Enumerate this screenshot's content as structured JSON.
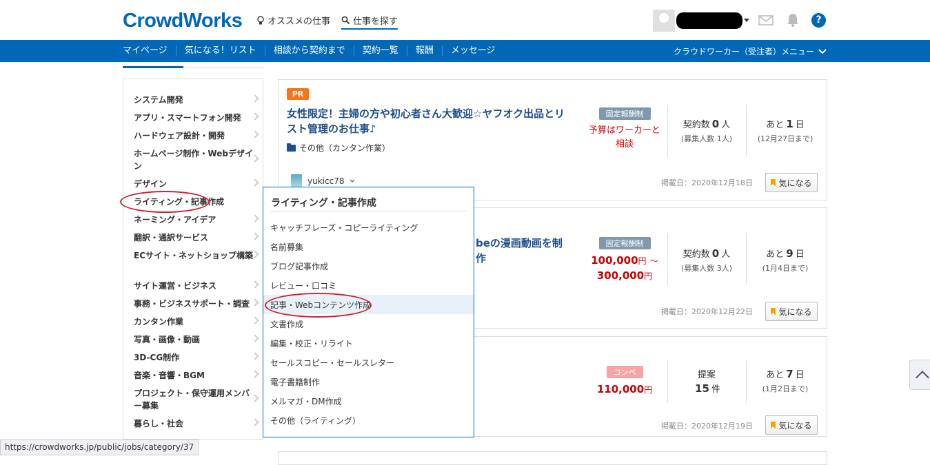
{
  "header": {
    "logo": "CrowdWorks",
    "recommended": "オススメの仕事",
    "search_jobs": "仕事を探す",
    "help": "?"
  },
  "nav": {
    "items": [
      "マイページ",
      "気になる！リスト",
      "相談から契約まで",
      "契約一覧",
      "報酬",
      "メッセージ"
    ],
    "role_menu": "クラウドワーカー（受注者）メニュー"
  },
  "sidebar": {
    "items": [
      "システム開発",
      "アプリ・スマートフォン開発",
      "ハードウェア設計・開発",
      "ホームページ制作・Webデザイン",
      "デザイン",
      "ライティング・記事作成",
      "ネーミング・アイデア",
      "翻訳・通訳サービス",
      "ECサイト・ネットショップ構築",
      "サイト運営・ビジネス",
      "事務・ビジネスサポート・調査",
      "カンタン作業",
      "写真・画像・動画",
      "3D-CG制作",
      "音楽・音響・BGM",
      "プロジェクト・保守運用メンバー募集",
      "暮らし・社会"
    ]
  },
  "flyout": {
    "title": "ライティング・記事作成",
    "items": [
      "キャッチフレーズ・コピーライティング",
      "名前募集",
      "ブログ記事作成",
      "レビュー・口コミ",
      "記事・Webコンテンツ作成",
      "文書作成",
      "編集・校正・リライト",
      "セールスコピー・セールスレター",
      "電子書籍制作",
      "メルマガ・DM作成",
      "その他（ライティング）"
    ]
  },
  "jobs": [
    {
      "pr": "PR",
      "title": "女性限定！主婦の方や初心者さん大歓迎☆ヤフオク出品とリスト管理のお仕事♪",
      "category": "その他（カンタン作業）",
      "type": "固定報酬制",
      "budget": "予算はワーカーと相談",
      "contracts_label": "契約数",
      "contracts": "0",
      "contracts_unit": "人",
      "recruit": "(募集人数 1人)",
      "remain_pre": "あと",
      "remain": "1",
      "remain_unit": "日",
      "deadline": "(12月27日まで)",
      "user": "yukicc78",
      "posted": "掲載日：2020年12月18日",
      "fav": "気になる"
    },
    {
      "title_tail": "beの漫画動画を制作",
      "type": "固定報酬制",
      "price_from": "100,000",
      "price_to": "300,000",
      "currency": "円",
      "range_sep": "～",
      "contracts_label": "契約数",
      "contracts": "0",
      "contracts_unit": "人",
      "recruit": "(募集人数 3人)",
      "remain_pre": "あと",
      "remain": "9",
      "remain_unit": "日",
      "deadline": "(1月4日まで)",
      "posted": "掲載日：2020年12月22日",
      "fav": "気になる"
    },
    {
      "type": "コンペ",
      "price": "110,000",
      "currency": "円",
      "proposal_label": "提案",
      "proposals": "15",
      "proposals_unit": "件",
      "remain_pre": "あと",
      "remain": "7",
      "remain_unit": "日",
      "deadline": "(1月2日まで)",
      "posted": "掲載日：2020年12月19日",
      "fav": "気になる"
    }
  ],
  "statusbar": {
    "url": "https://crowdworks.jp/public/jobs/category/37"
  },
  "colors": {
    "brand": "#0068b7",
    "pr": "#f5761a",
    "price": "#cc0000",
    "annotation": "#d0202a"
  }
}
